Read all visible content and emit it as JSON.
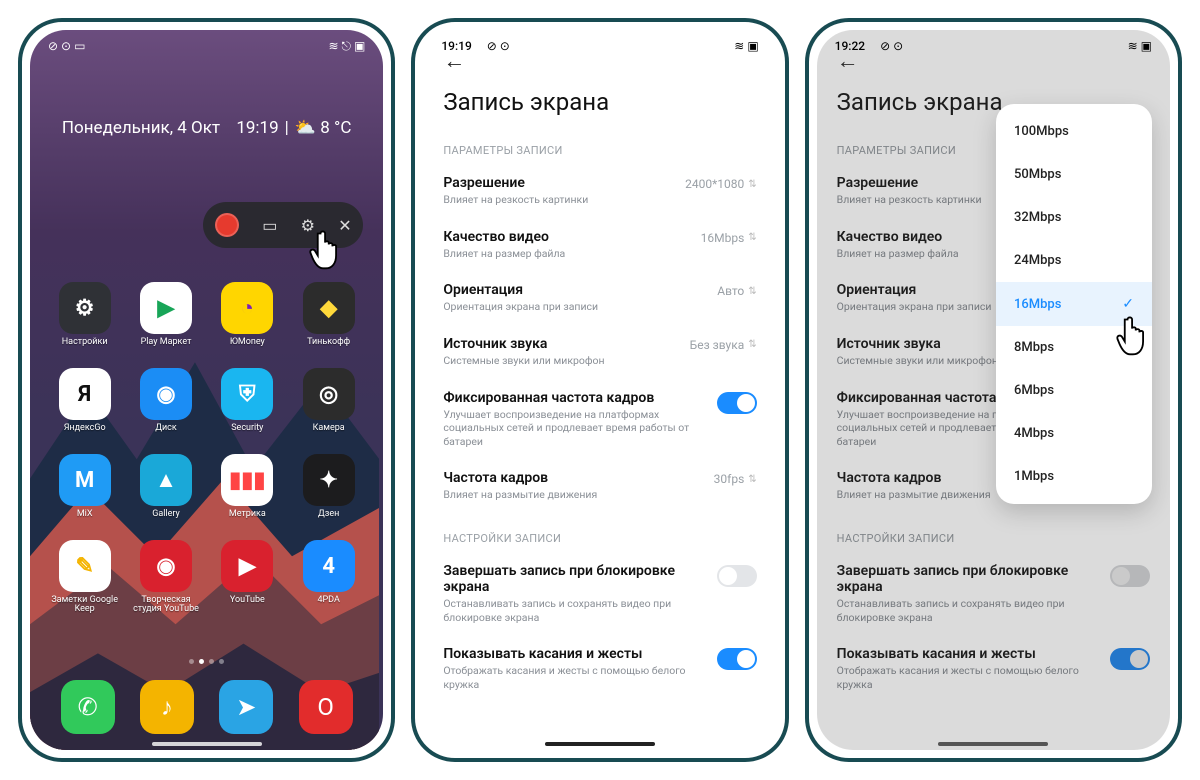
{
  "colors": {
    "accent": "#1A8CFF",
    "record": "#E63A2E"
  },
  "phone1": {
    "status": {
      "time": "",
      "icons_left": "⊘ ⊙ ▭",
      "icons_right": "≋ ⎋ ▣"
    },
    "weather": {
      "day": "Понедельник, 4 Окт",
      "time": "19:19",
      "sep": "|",
      "cond": "⛅ 8 °C"
    },
    "apps": [
      {
        "label": "Настройки",
        "bg": "#2F3136",
        "glyph": "⚙"
      },
      {
        "label": "Play Маркет",
        "bg": "#FFFFFF",
        "glyph": "▶",
        "fg": "#18A558"
      },
      {
        "label": "ЮMoney",
        "bg": "#FFD600",
        "glyph": "◔",
        "fg": "#7A1FB8"
      },
      {
        "label": "Тинькофф",
        "bg": "#2C2C2C",
        "glyph": "◆",
        "fg": "#FFD93B"
      },
      {
        "label": "ЯндексGo",
        "bg": "#FFFFFF",
        "glyph": "Я",
        "fg": "#111"
      },
      {
        "label": "Диск",
        "bg": "#1B8DF5",
        "glyph": "◉"
      },
      {
        "label": "Security",
        "bg": "#1AB6F0",
        "glyph": "⛨"
      },
      {
        "label": "Камера",
        "bg": "#2C2C2C",
        "glyph": "◎"
      },
      {
        "label": "MiX",
        "bg": "#1F9BF5",
        "glyph": "M"
      },
      {
        "label": "Gallery",
        "bg": "#1AA8D8",
        "glyph": "▲"
      },
      {
        "label": "Метрика",
        "bg": "#FFFFFF",
        "glyph": "▮▮▮",
        "fg": "#F44"
      },
      {
        "label": "Дзен",
        "bg": "#1C1C1E",
        "glyph": "✦"
      },
      {
        "label": "Заметки Google Keep",
        "bg": "#FFFFFF",
        "glyph": "✎",
        "fg": "#F4B400"
      },
      {
        "label": "Творческая студия YouTube",
        "bg": "#D9212E",
        "glyph": "◉"
      },
      {
        "label": "YouTube",
        "bg": "#D9212E",
        "glyph": "▶"
      },
      {
        "label": "4PDA",
        "bg": "#1A8CFF",
        "glyph": "4"
      }
    ],
    "dock": [
      {
        "name": "phone",
        "bg": "#31C95B",
        "glyph": "✆"
      },
      {
        "name": "music",
        "bg": "#F4B400",
        "glyph": "♪"
      },
      {
        "name": "telegram",
        "bg": "#2AA4E4",
        "glyph": "➤"
      },
      {
        "name": "opera",
        "bg": "#E22C2C",
        "glyph": "O"
      }
    ]
  },
  "phone2": {
    "status": {
      "time": "19:19",
      "icons_left": "⊘ ⊙",
      "icons_right": "≋ ▣"
    },
    "title": "Запись экрана",
    "sect1": "ПАРАМЕТРЫ ЗАПИСИ",
    "rows": [
      {
        "t": "Разрешение",
        "d": "Влияет на резкость картинки",
        "v": "2400*1080"
      },
      {
        "t": "Качество видео",
        "d": "Влияет на размер файла",
        "v": "16Mbps"
      },
      {
        "t": "Ориентация",
        "d": "Ориентация экрана при записи",
        "v": "Авто"
      },
      {
        "t": "Источник звука",
        "d": "Системные звуки или микрофон",
        "v": "Без звука"
      }
    ],
    "row_ffr": {
      "t": "Фиксированная частота кадров",
      "d": "Улучшает воспроизведение на платформах социальных сетей и продлевает время работы от батареи"
    },
    "row_fps": {
      "t": "Частота кадров",
      "d": "Влияет на размытие движения",
      "v": "30fps"
    },
    "sect2": "НАСТРОЙКИ ЗАПИСИ",
    "row_lock": {
      "t": "Завершать запись при блокировке экрана",
      "d": "Останавливать запись и сохранять видео при блокировке экрана"
    },
    "row_touch": {
      "t": "Показывать касания и жесты",
      "d": "Отображать касания и жесты с помощью белого кружка"
    }
  },
  "phone3": {
    "status": {
      "time": "19:22",
      "icons_left": "⊘ ⊙",
      "icons_right": "≋ ▣"
    },
    "popup": {
      "options": [
        "100Mbps",
        "50Mbps",
        "32Mbps",
        "24Mbps",
        "16Mbps",
        "8Mbps",
        "6Mbps",
        "4Mbps",
        "1Mbps"
      ],
      "selected": "16Mbps"
    }
  }
}
